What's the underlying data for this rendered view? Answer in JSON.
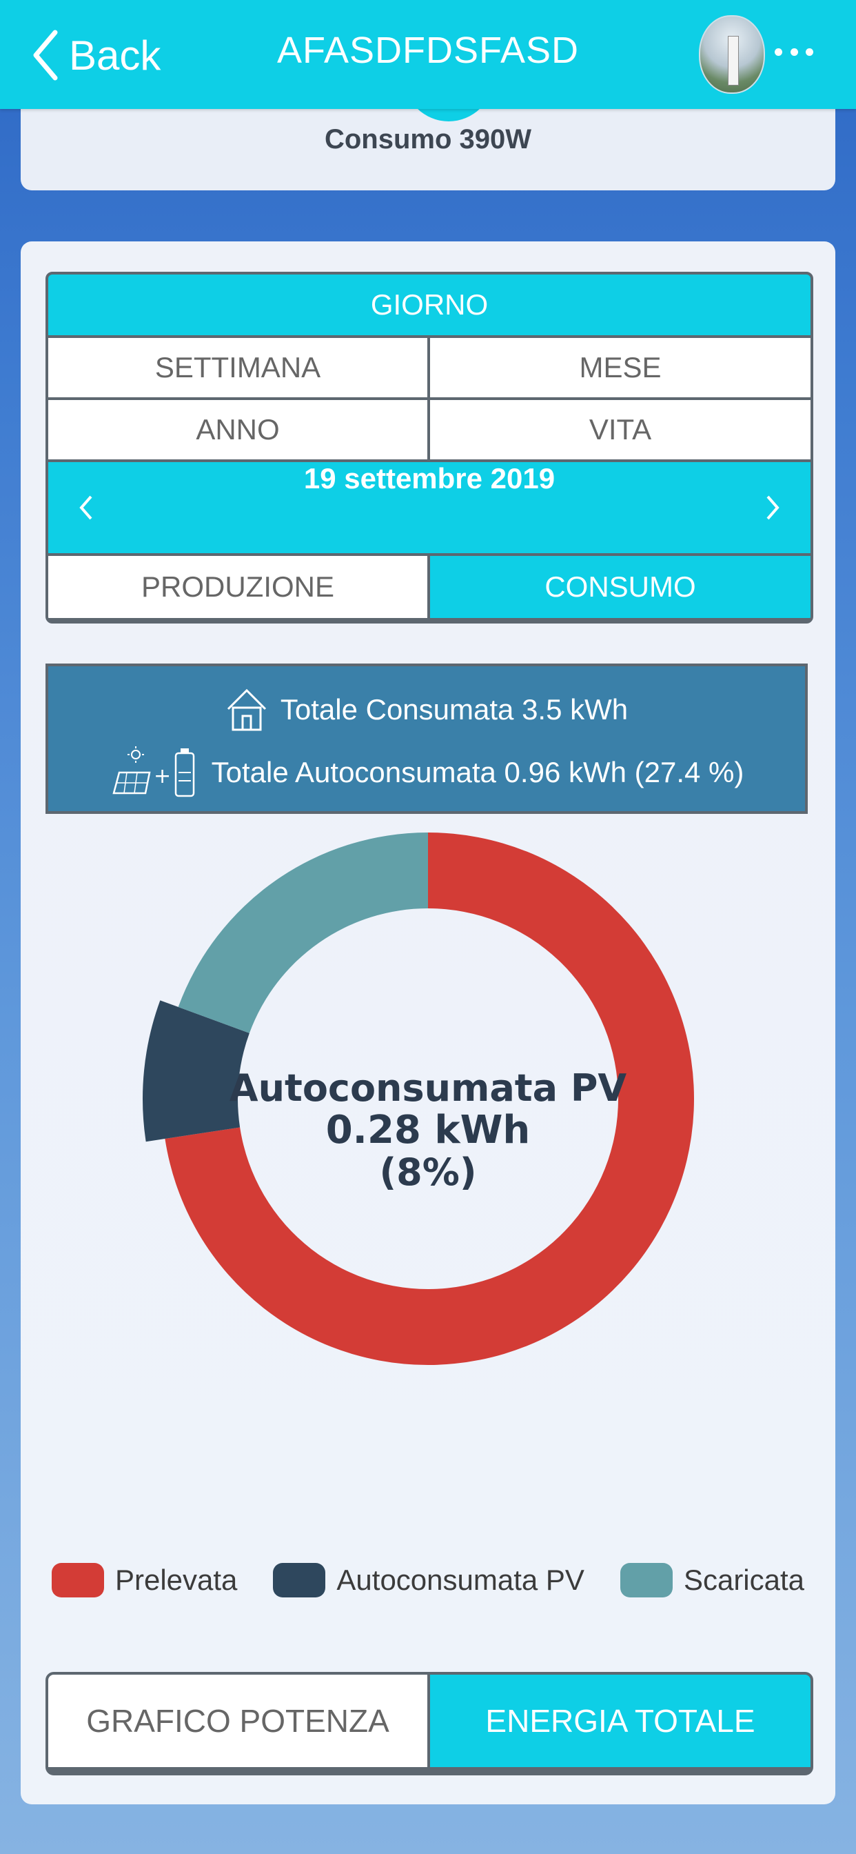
{
  "header": {
    "back_label": "Back",
    "title": "AFASDFDSFASD"
  },
  "top_card": {
    "consumo_label": "Consumo  390W"
  },
  "period_tabs": {
    "giorno": "GIORNO",
    "settimana": "SETTIMANA",
    "mese": "MESE",
    "anno": "ANNO",
    "vita": "VITA",
    "active": "GIORNO"
  },
  "date_nav": {
    "date": "19 settembre 2019",
    "prev_icon": "chevron-left-icon",
    "next_icon": "chevron-right-icon"
  },
  "mode_tabs": {
    "produzione": "PRODUZIONE",
    "consumo": "CONSUMO",
    "active": "CONSUMO"
  },
  "totals": {
    "consumata": "Totale Consumata 3.5 kWh",
    "autoconsumata": "Totale Autoconsumata 0.96 kWh (27.4 %)"
  },
  "chart_data": {
    "type": "pie",
    "categories": [
      "Prelevata",
      "Autoconsumata PV",
      "Scaricata"
    ],
    "values": [
      72.6,
      8,
      19.4
    ],
    "colors": [
      "#d33c36",
      "#2e475d",
      "#62a0a8"
    ],
    "highlighted": "Autoconsumata PV",
    "center_label": {
      "line1": "Autoconsumata PV",
      "line2": "0.28 kWh",
      "line3": "(8%)"
    }
  },
  "legend": [
    {
      "label": "Prelevata",
      "color": "#d33c36"
    },
    {
      "label": "Autoconsumata PV",
      "color": "#2e475d"
    },
    {
      "label": "Scaricata",
      "color": "#62a0a8"
    }
  ],
  "bottom_tabs": {
    "grafico": "GRAFICO POTENZA",
    "energia": "ENERGIA TOTALE",
    "active": "ENERGIA TOTALE"
  },
  "colors": {
    "accent": "#0ecfe6",
    "panel_border": "#5d6770",
    "totals_bg": "#3a80a9"
  }
}
